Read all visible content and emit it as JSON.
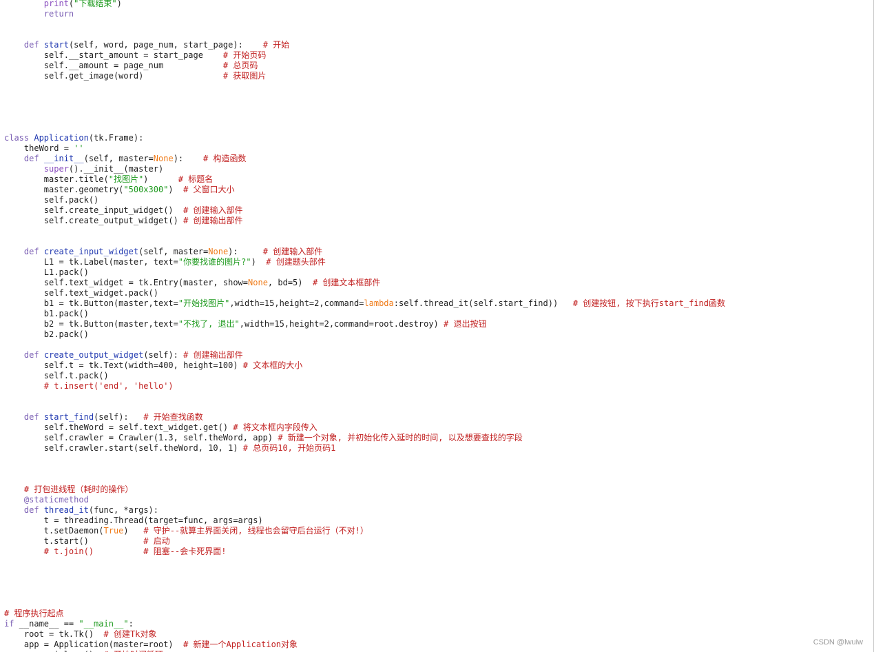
{
  "colors": {
    "background": "#ffffff",
    "keyword": "#7b5fb4",
    "function_name": "#2038b0",
    "string": "#1e9a1e",
    "comment": "#c11f1f",
    "builtin": "#8a4fbf",
    "constant": "#f07c1a",
    "text": "#1f1f1f"
  },
  "watermark": "CSDN @lwuiw",
  "code_lines": [
    [
      {
        "t": "        ",
        "c": "tx"
      },
      {
        "t": "print",
        "c": "bi"
      },
      {
        "t": "(",
        "c": "tx"
      },
      {
        "t": "\"下载结束\"",
        "c": "str"
      },
      {
        "t": ")",
        "c": "tx"
      }
    ],
    [
      {
        "t": "        ",
        "c": "tx"
      },
      {
        "t": "return",
        "c": "kw"
      }
    ],
    [],
    [],
    [
      {
        "t": "    ",
        "c": "tx"
      },
      {
        "t": "def",
        "c": "kw"
      },
      {
        "t": " ",
        "c": "tx"
      },
      {
        "t": "start",
        "c": "fn"
      },
      {
        "t": "(self, word, page_num, start_page):    ",
        "c": "tx"
      },
      {
        "t": "# 开始",
        "c": "cm"
      }
    ],
    [
      {
        "t": "        self.__start_amount = start_page    ",
        "c": "tx"
      },
      {
        "t": "# 开始页码",
        "c": "cm"
      }
    ],
    [
      {
        "t": "        self.__amount = page_num            ",
        "c": "tx"
      },
      {
        "t": "# 总页码",
        "c": "cm"
      }
    ],
    [
      {
        "t": "        self.get_image(word)                ",
        "c": "tx"
      },
      {
        "t": "# 获取图片",
        "c": "cm"
      }
    ],
    [],
    [],
    [],
    [],
    [],
    [
      {
        "t": "class",
        "c": "kw"
      },
      {
        "t": " ",
        "c": "tx"
      },
      {
        "t": "Application",
        "c": "fn"
      },
      {
        "t": "(tk.Frame):",
        "c": "tx"
      }
    ],
    [
      {
        "t": "    theWord = ",
        "c": "tx"
      },
      {
        "t": "''",
        "c": "str"
      }
    ],
    [
      {
        "t": "    ",
        "c": "tx"
      },
      {
        "t": "def",
        "c": "kw"
      },
      {
        "t": " ",
        "c": "tx"
      },
      {
        "t": "__init__",
        "c": "fn"
      },
      {
        "t": "(self, master=",
        "c": "tx"
      },
      {
        "t": "None",
        "c": "cn"
      },
      {
        "t": "):    ",
        "c": "tx"
      },
      {
        "t": "# 构造函数",
        "c": "cm"
      }
    ],
    [
      {
        "t": "        ",
        "c": "tx"
      },
      {
        "t": "super",
        "c": "bi"
      },
      {
        "t": "().__init__(master)",
        "c": "tx"
      }
    ],
    [
      {
        "t": "        master.title(",
        "c": "tx"
      },
      {
        "t": "\"找图片\"",
        "c": "str"
      },
      {
        "t": ")      ",
        "c": "tx"
      },
      {
        "t": "# 标题名",
        "c": "cm"
      }
    ],
    [
      {
        "t": "        master.geometry(",
        "c": "tx"
      },
      {
        "t": "\"500x300\"",
        "c": "str"
      },
      {
        "t": ")  ",
        "c": "tx"
      },
      {
        "t": "# 父窗口大小",
        "c": "cm"
      }
    ],
    [
      {
        "t": "        self.pack()",
        "c": "tx"
      }
    ],
    [
      {
        "t": "        self.create_input_widget()  ",
        "c": "tx"
      },
      {
        "t": "# 创建输入部件",
        "c": "cm"
      }
    ],
    [
      {
        "t": "        self.create_output_widget() ",
        "c": "tx"
      },
      {
        "t": "# 创建输出部件",
        "c": "cm"
      }
    ],
    [],
    [],
    [
      {
        "t": "    ",
        "c": "tx"
      },
      {
        "t": "def",
        "c": "kw"
      },
      {
        "t": " ",
        "c": "tx"
      },
      {
        "t": "create_input_widget",
        "c": "fn"
      },
      {
        "t": "(self, master=",
        "c": "tx"
      },
      {
        "t": "None",
        "c": "cn"
      },
      {
        "t": "):     ",
        "c": "tx"
      },
      {
        "t": "# 创建输入部件",
        "c": "cm"
      }
    ],
    [
      {
        "t": "        L1 = tk.Label(master, text=",
        "c": "tx"
      },
      {
        "t": "\"你要找谁的图片?\"",
        "c": "str"
      },
      {
        "t": ")  ",
        "c": "tx"
      },
      {
        "t": "# 创建题头部件",
        "c": "cm"
      }
    ],
    [
      {
        "t": "        L1.pack()",
        "c": "tx"
      }
    ],
    [
      {
        "t": "        self.text_widget = tk.Entry(master, show=",
        "c": "tx"
      },
      {
        "t": "None",
        "c": "cn"
      },
      {
        "t": ", bd=5)  ",
        "c": "tx"
      },
      {
        "t": "# 创建文本框部件",
        "c": "cm"
      }
    ],
    [
      {
        "t": "        self.text_widget.pack()",
        "c": "tx"
      }
    ],
    [
      {
        "t": "        b1 = tk.Button(master,text=",
        "c": "tx"
      },
      {
        "t": "\"开始找图片\"",
        "c": "str"
      },
      {
        "t": ",width=15,height=2,command=",
        "c": "tx"
      },
      {
        "t": "lambda",
        "c": "cn"
      },
      {
        "t": ":self.thread_it(self.start_find))   ",
        "c": "tx"
      },
      {
        "t": "# 创建按钮, 按下执行start_find函数",
        "c": "cm"
      }
    ],
    [
      {
        "t": "        b1.pack()",
        "c": "tx"
      }
    ],
    [
      {
        "t": "        b2 = tk.Button(master,text=",
        "c": "tx"
      },
      {
        "t": "\"不找了, 退出\"",
        "c": "str"
      },
      {
        "t": ",width=15,height=2,command=root.destroy) ",
        "c": "tx"
      },
      {
        "t": "# 退出按钮",
        "c": "cm"
      }
    ],
    [
      {
        "t": "        b2.pack()",
        "c": "tx"
      }
    ],
    [],
    [
      {
        "t": "    ",
        "c": "tx"
      },
      {
        "t": "def",
        "c": "kw"
      },
      {
        "t": " ",
        "c": "tx"
      },
      {
        "t": "create_output_widget",
        "c": "fn"
      },
      {
        "t": "(self): ",
        "c": "tx"
      },
      {
        "t": "# 创建输出部件",
        "c": "cm"
      }
    ],
    [
      {
        "t": "        self.t = tk.Text(width=400, height=100) ",
        "c": "tx"
      },
      {
        "t": "# 文本框的大小",
        "c": "cm"
      }
    ],
    [
      {
        "t": "        self.t.pack()",
        "c": "tx"
      }
    ],
    [
      {
        "t": "        ",
        "c": "tx"
      },
      {
        "t": "# t.insert('end', 'hello')",
        "c": "cm"
      }
    ],
    [],
    [],
    [
      {
        "t": "    ",
        "c": "tx"
      },
      {
        "t": "def",
        "c": "kw"
      },
      {
        "t": " ",
        "c": "tx"
      },
      {
        "t": "start_find",
        "c": "fn"
      },
      {
        "t": "(self):   ",
        "c": "tx"
      },
      {
        "t": "# 开始查找函数",
        "c": "cm"
      }
    ],
    [
      {
        "t": "        self.theWord = self.text_widget.get() ",
        "c": "tx"
      },
      {
        "t": "# 将文本框内字段传入",
        "c": "cm"
      }
    ],
    [
      {
        "t": "        self.crawler = Crawler(1.3, self.theWord, app) ",
        "c": "tx"
      },
      {
        "t": "# 新建一个对象, 并初始化传入延时的时间, 以及想要查找的字段",
        "c": "cm"
      }
    ],
    [
      {
        "t": "        self.crawler.start(self.theWord, 10, 1) ",
        "c": "tx"
      },
      {
        "t": "# 总页码10, 开始页码1",
        "c": "cm"
      }
    ],
    [],
    [],
    [],
    [
      {
        "t": "    ",
        "c": "tx"
      },
      {
        "t": "# 打包进线程（耗时的操作）",
        "c": "cm"
      }
    ],
    [
      {
        "t": "    ",
        "c": "tx"
      },
      {
        "t": "@staticmethod",
        "c": "dc"
      }
    ],
    [
      {
        "t": "    ",
        "c": "tx"
      },
      {
        "t": "def",
        "c": "kw"
      },
      {
        "t": " ",
        "c": "tx"
      },
      {
        "t": "thread_it",
        "c": "fn"
      },
      {
        "t": "(func, *args):",
        "c": "tx"
      }
    ],
    [
      {
        "t": "        t = threading.Thread(target=func, args=args)",
        "c": "tx"
      }
    ],
    [
      {
        "t": "        t.setDaemon(",
        "c": "tx"
      },
      {
        "t": "True",
        "c": "cn"
      },
      {
        "t": ")   ",
        "c": "tx"
      },
      {
        "t": "# 守护--就算主界面关闭, 线程也会留守后台运行（不对!）",
        "c": "cm"
      }
    ],
    [
      {
        "t": "        t.start()           ",
        "c": "tx"
      },
      {
        "t": "# 启动",
        "c": "cm"
      }
    ],
    [
      {
        "t": "        ",
        "c": "tx"
      },
      {
        "t": "# t.join()          # 阻塞--会卡死界面!",
        "c": "cm"
      }
    ],
    [],
    [],
    [],
    [],
    [],
    [
      {
        "t": "# 程序执行起点",
        "c": "cm"
      }
    ],
    [
      {
        "t": "if",
        "c": "kw"
      },
      {
        "t": " __name__ == ",
        "c": "tx"
      },
      {
        "t": "\"__main__\"",
        "c": "str"
      },
      {
        "t": ":",
        "c": "tx"
      }
    ],
    [
      {
        "t": "    root = tk.Tk()  ",
        "c": "tx"
      },
      {
        "t": "# 创建Tk对象",
        "c": "cm"
      }
    ],
    [
      {
        "t": "    app = Application(master=root)  ",
        "c": "tx"
      },
      {
        "t": "# 新建一个Application对象",
        "c": "cm"
      }
    ],
    [
      {
        "t": "    app.mainloop()  ",
        "c": "tx"
      },
      {
        "t": "# 开始时间循环",
        "c": "cm"
      }
    ]
  ]
}
